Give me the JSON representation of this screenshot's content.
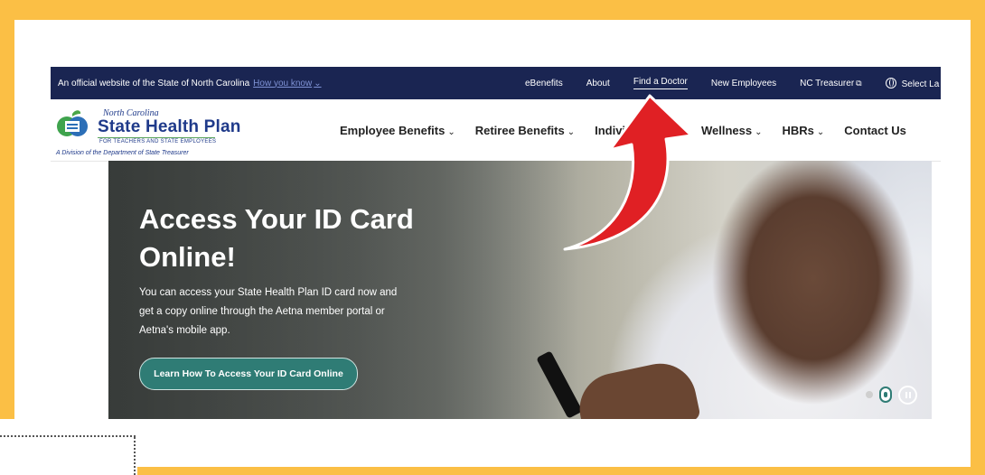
{
  "topbar": {
    "official_text": "An official website of the State of North Carolina",
    "how_you_know": "How you know",
    "links": [
      "eBenefits",
      "About",
      "Find a Doctor",
      "New Employees",
      "NC Treasurer"
    ],
    "select_language": "Select La"
  },
  "logo": {
    "north_carolina": "North Carolina",
    "name": "State Health Plan",
    "subtitle": "FOR TEACHERS AND STATE EMPLOYEES",
    "division": "A Division of the Department of State Treasurer"
  },
  "nav": {
    "items": [
      "Employee Benefits",
      "Retiree Benefits",
      "Individ",
      "Wellness",
      "HBRs",
      "Contact Us"
    ]
  },
  "hero": {
    "title": "Access Your ID Card Online!",
    "text": "You can access your State Health Plan ID card now and get a copy online through the Aetna member portal or Aetna's mobile app.",
    "button": "Learn How To Access Your ID Card Online"
  },
  "colors": {
    "frame": "#fbbf45",
    "topbar": "#1a2552",
    "brand_blue": "#1f3a8a",
    "button_teal": "#2f7c75",
    "arrow_red": "#e02024"
  }
}
